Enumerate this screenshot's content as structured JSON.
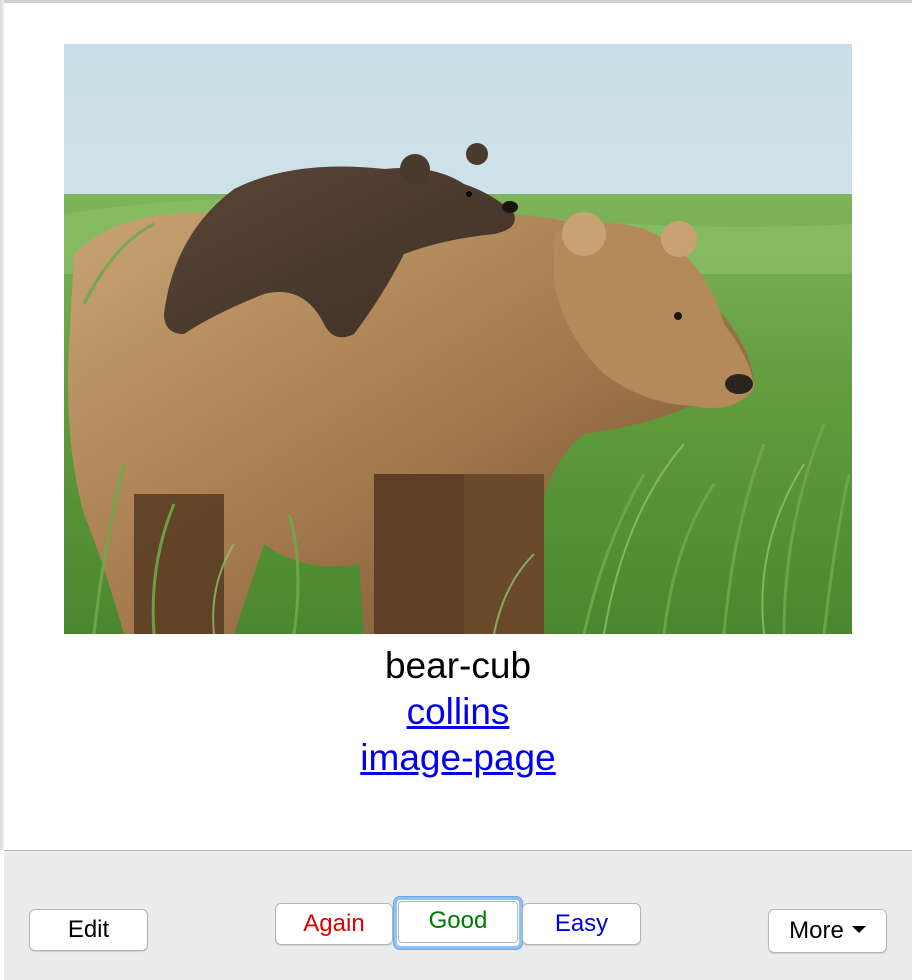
{
  "card": {
    "image_alt": "Brown bear with cub on its back in tall green grass",
    "word": "bear-cub",
    "links": [
      "collins",
      "image-page"
    ]
  },
  "buttons": {
    "edit": "Edit",
    "again": "Again",
    "good": "Good",
    "easy": "Easy",
    "more": "More"
  },
  "colors": {
    "again": "#e00000",
    "good": "#007a00",
    "easy": "#0000e0",
    "link": "#0000ee",
    "focus_ring": "#6aa9ea"
  },
  "icons": {
    "more_dropdown": "chevron-down-icon"
  }
}
